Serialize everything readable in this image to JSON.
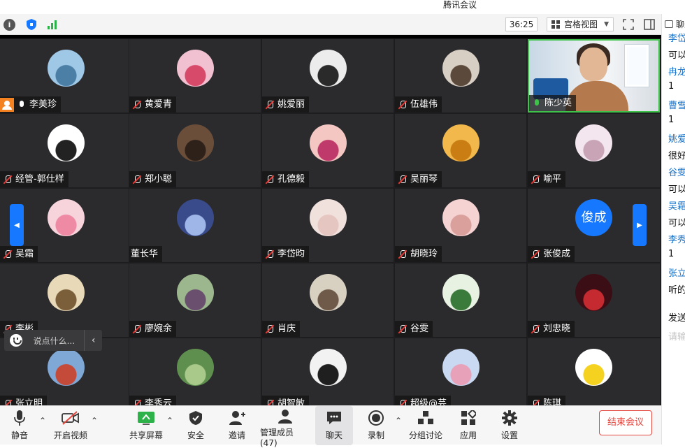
{
  "window": {
    "title": "腾讯会议"
  },
  "toolbar": {
    "timer": "36:25",
    "view_label": "宫格视图",
    "icons": [
      "info-icon",
      "shield-icon",
      "signal-icon",
      "fullscreen-icon",
      "sidebar-toggle-icon"
    ]
  },
  "participants": [
    {
      "name": "李美珍",
      "mic": "on",
      "host": true
    },
    {
      "name": "黄爱青",
      "mic": "muted"
    },
    {
      "name": "姚爱丽",
      "mic": "muted"
    },
    {
      "name": "伍雄伟",
      "mic": "muted"
    },
    {
      "name": "陈少英",
      "mic": "speaking",
      "video": true
    },
    {
      "name": "经管-郭仕样",
      "mic": "muted"
    },
    {
      "name": "郑小聪",
      "mic": "muted"
    },
    {
      "name": "孔德毅",
      "mic": "muted"
    },
    {
      "name": "吴丽琴",
      "mic": "muted"
    },
    {
      "name": "喻平",
      "mic": "muted"
    },
    {
      "name": "吴霜",
      "mic": "muted"
    },
    {
      "name": "董长华",
      "mic": "none"
    },
    {
      "name": "李岱昀",
      "mic": "muted"
    },
    {
      "name": "胡晓玲",
      "mic": "muted"
    },
    {
      "name": "张俊成",
      "mic": "muted",
      "initials": "俊成"
    },
    {
      "name": "李彬",
      "mic": "muted"
    },
    {
      "name": "廖婉余",
      "mic": "muted"
    },
    {
      "name": "肖庆",
      "mic": "muted"
    },
    {
      "name": "谷雯",
      "mic": "muted"
    },
    {
      "name": "刘忠晓",
      "mic": "muted"
    },
    {
      "name": "张立明",
      "mic": "muted"
    },
    {
      "name": "李秀云",
      "mic": "muted"
    },
    {
      "name": "胡智敏",
      "mic": "muted"
    },
    {
      "name": "超级@芸",
      "mic": "muted"
    },
    {
      "name": "陈琪",
      "mic": "muted"
    }
  ],
  "chat_float": {
    "placeholder": "说点什么..."
  },
  "bottombar": {
    "mute": "静音",
    "video": "开启视频",
    "share": "共享屏幕",
    "security": "安全",
    "invite": "邀请",
    "members": "管理成员(47)",
    "chat": "聊天",
    "record": "录制",
    "breakout": "分组讨论",
    "apps": "应用",
    "settings": "设置",
    "end": "结束会议"
  },
  "chat_panel": {
    "title": "聊天",
    "lines": [
      {
        "type": "sender",
        "text": "李岱"
      },
      {
        "type": "msg",
        "text": "可以"
      },
      {
        "type": "sender",
        "text": "冉龙"
      },
      {
        "type": "msg",
        "text": "1"
      },
      {
        "type": "sender",
        "text": "曹雪"
      },
      {
        "type": "msg",
        "text": "1"
      },
      {
        "type": "sender",
        "text": "姚爱"
      },
      {
        "type": "msg",
        "text": "很好"
      },
      {
        "type": "sender",
        "text": "谷雯"
      },
      {
        "type": "msg",
        "text": "可以"
      },
      {
        "type": "sender",
        "text": "吴霜"
      },
      {
        "type": "msg",
        "text": "可以"
      },
      {
        "type": "sender",
        "text": "李秀"
      },
      {
        "type": "msg",
        "text": "1"
      },
      {
        "type": "sender",
        "text": "张立"
      },
      {
        "type": "msg",
        "text": "听的"
      },
      {
        "type": "msg",
        "text": "发送"
      },
      {
        "type": "hint",
        "text": "请输"
      }
    ]
  },
  "colors": {
    "accent": "#1677ff",
    "danger": "#e5473f",
    "speaking": "#3ec24a",
    "host": "#f58220"
  }
}
